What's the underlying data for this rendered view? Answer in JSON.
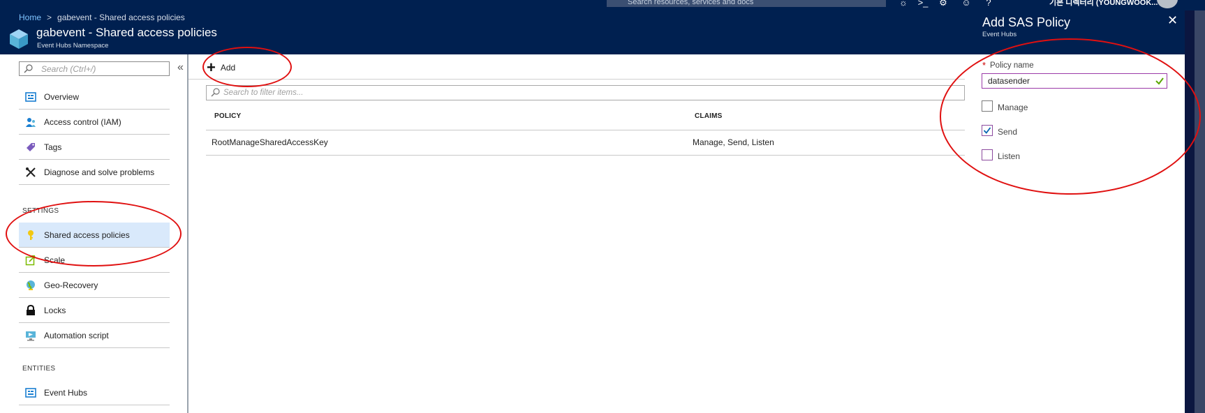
{
  "topbar": {
    "search_placeholder": "Search resources, services and docs",
    "user_label": "기본 디렉터리 (YOUNGWOOK..."
  },
  "breadcrumb": {
    "home": "Home",
    "separator": ">",
    "current": "gabevent - Shared access policies"
  },
  "header": {
    "title": "gabevent - Shared access policies",
    "subtitle": "Event Hubs Namespace"
  },
  "sidebar": {
    "search_placeholder": "Search (Ctrl+/)",
    "collapse_glyph": "«",
    "items": [
      {
        "label": "Overview",
        "icon": "overview-icon"
      },
      {
        "label": "Access control (IAM)",
        "icon": "iam-icon"
      },
      {
        "label": "Tags",
        "icon": "tag-icon"
      },
      {
        "label": "Diagnose and solve problems",
        "icon": "wrench-icon"
      }
    ],
    "settings_header": "SETTINGS",
    "settings_items": [
      {
        "label": "Shared access policies",
        "icon": "key-icon",
        "selected": true
      },
      {
        "label": "Scale",
        "icon": "scale-icon"
      },
      {
        "label": "Geo-Recovery",
        "icon": "globe-icon"
      },
      {
        "label": "Locks",
        "icon": "lock-icon"
      },
      {
        "label": "Automation script",
        "icon": "automation-icon"
      }
    ],
    "entities_header": "ENTITIES",
    "entities_items": [
      {
        "label": "Event Hubs",
        "icon": "event-hubs-icon"
      }
    ]
  },
  "toolbar": {
    "add_label": "Add"
  },
  "main": {
    "filter_placeholder": "Search to filter items...",
    "columns": [
      "POLICY",
      "CLAIMS"
    ],
    "rows": [
      {
        "policy": "RootManageSharedAccessKey",
        "claims": "Manage, Send, Listen"
      }
    ]
  },
  "panel": {
    "title": "Add SAS Policy",
    "subtitle": "Event Hubs",
    "close_glyph": "✕",
    "required_mark": "*",
    "policy_name_label": "Policy name",
    "policy_name_value": "datasender",
    "checkboxes": [
      {
        "label": "Manage",
        "checked": false
      },
      {
        "label": "Send",
        "checked": true
      },
      {
        "label": "Listen",
        "checked": false
      }
    ]
  },
  "colors": {
    "header_bg": "#002050",
    "accent_link": "#7fc4ff",
    "selected_bg": "#d9e9fb",
    "annotation_red": "#e01010",
    "valid_green": "#5aa700",
    "checkbox_purple": "#8c4a9e"
  }
}
